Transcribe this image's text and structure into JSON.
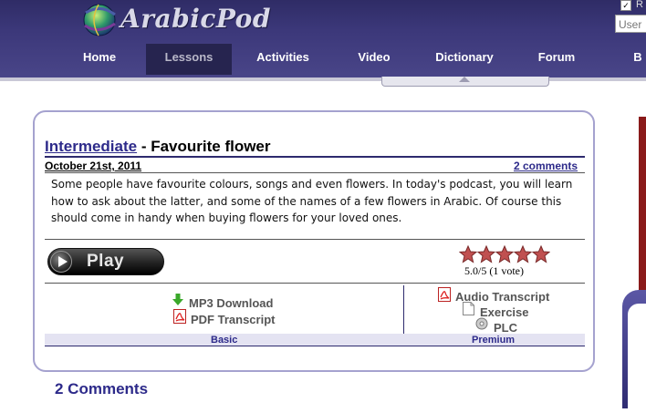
{
  "header": {
    "logo_text": "ArabicPod",
    "nav": [
      "Home",
      "Lessons",
      "Activities",
      "Video",
      "Dictionary",
      "Forum",
      "B"
    ],
    "active_nav": "Lessons",
    "remember_label": "R",
    "user_placeholder": "User"
  },
  "lesson": {
    "level": "Intermediate",
    "separator": " - ",
    "title": "Favourite flower",
    "date": "October 21st, 2011",
    "comments_link": "2 comments",
    "description": "Some people have favourite colours, songs and even flowers. In today's podcast, you will learn how to ask about the latter, and some of the names of a few flowers in Arabic. Of course this should come in handy when buying flowers for your loved ones.",
    "play_label": "Play",
    "rating": {
      "stars": 5,
      "max": 5,
      "text": "5.0/5 (1 vote)"
    },
    "basic": {
      "label": "Basic",
      "items": [
        {
          "icon": "green-arrow-down-icon",
          "label": "MP3 Download"
        },
        {
          "icon": "pdf-icon",
          "label": "PDF Transcript"
        }
      ]
    },
    "premium": {
      "label": "Premium",
      "items": [
        {
          "icon": "pdf-icon",
          "label": "Audio Transcript"
        },
        {
          "icon": "document-icon",
          "label": "Exercise"
        },
        {
          "icon": "disc-icon",
          "label": "PLC"
        }
      ]
    }
  },
  "comments_section": {
    "heading": "2 Comments"
  },
  "colors": {
    "header_bg": "#3c387a",
    "link": "#2d2a8a",
    "box_border": "#a5a2cf",
    "star_fill": "#c05050"
  }
}
